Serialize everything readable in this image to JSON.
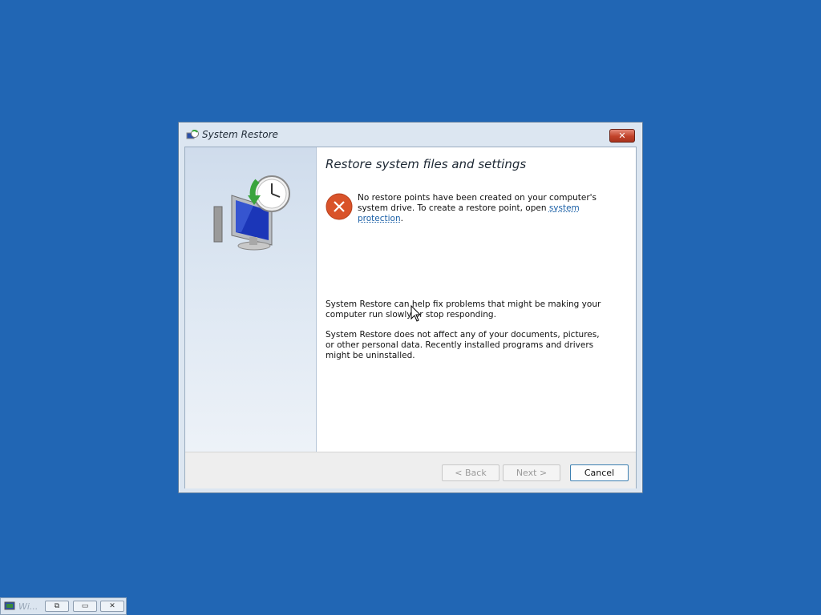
{
  "window": {
    "title": "System Restore",
    "close_glyph": "✕"
  },
  "main": {
    "heading": "Restore system files and settings",
    "error": {
      "icon": "error-icon",
      "text_before_link": "No restore points have been created on your computer's system drive. To create a restore point, open ",
      "link_text": "system protection",
      "text_after_link": "."
    },
    "paragraph1": "System Restore can help fix problems that might be making your computer run slowly or stop responding.",
    "paragraph2": "System Restore does not affect any of your documents, pictures, or other personal data. Recently installed programs and drivers might be uninstalled."
  },
  "buttons": {
    "back": "< Back",
    "next": "Next >",
    "cancel": "Cancel"
  },
  "taskbar": {
    "label": "Wi...",
    "restore_glyph": "⧉",
    "max_glyph": "▭",
    "close_glyph": "✕"
  },
  "colors": {
    "desktop": "#2166b4",
    "link": "#1a5fa6",
    "error": "#d9532a"
  }
}
